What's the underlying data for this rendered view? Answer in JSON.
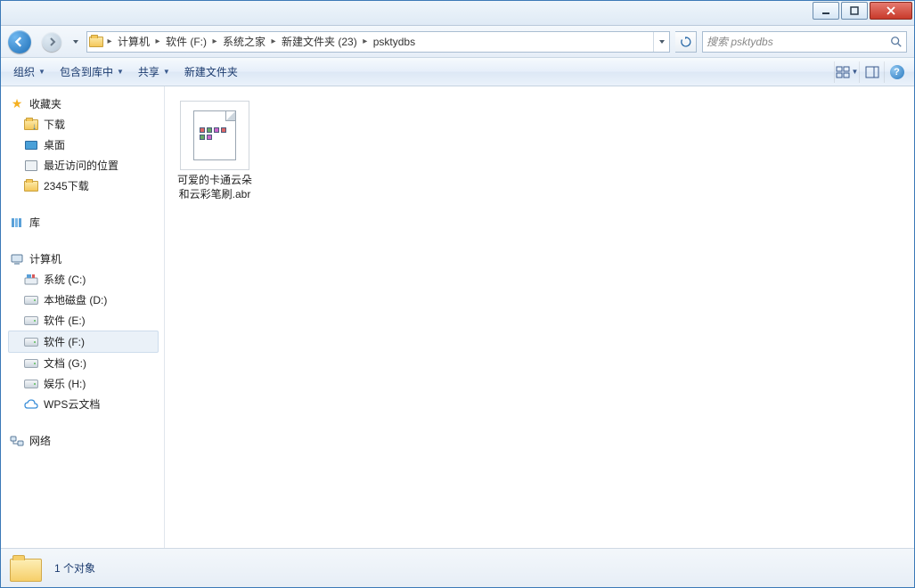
{
  "breadcrumb": {
    "items": [
      "计算机",
      "软件 (F:)",
      "系统之家",
      "新建文件夹 (23)",
      "psktydbs"
    ]
  },
  "search": {
    "placeholder": "搜索 psktydbs"
  },
  "toolbar": {
    "organize": "组织",
    "include": "包含到库中",
    "share": "共享",
    "newfolder": "新建文件夹"
  },
  "sidebar": {
    "favorites": {
      "label": "收藏夹",
      "items": [
        {
          "label": "下载"
        },
        {
          "label": "桌面"
        },
        {
          "label": "最近访问的位置"
        },
        {
          "label": "2345下载"
        }
      ]
    },
    "libraries": {
      "label": "库"
    },
    "computer": {
      "label": "计算机",
      "items": [
        {
          "label": "系统 (C:)"
        },
        {
          "label": "本地磁盘 (D:)"
        },
        {
          "label": "软件 (E:)"
        },
        {
          "label": "软件 (F:)",
          "selected": true
        },
        {
          "label": "文档 (G:)"
        },
        {
          "label": "娱乐 (H:)"
        },
        {
          "label": "WPS云文档"
        }
      ]
    },
    "network": {
      "label": "网络"
    }
  },
  "files": {
    "items": [
      {
        "name": "可爱的卡通云朵和云彩笔刷.abr"
      }
    ]
  },
  "status": {
    "count_text": "1 个对象"
  }
}
